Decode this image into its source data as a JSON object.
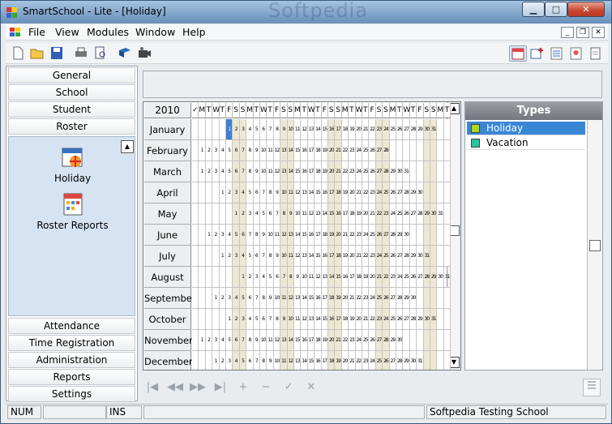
{
  "window": {
    "title": "SmartSchool - Lite - [Holiday]",
    "watermark": "Softpedia",
    "controls": {
      "minimize": "▁",
      "maximize": "□",
      "close": "✕"
    }
  },
  "menu": {
    "items": [
      "File",
      "View",
      "Modules",
      "Window",
      "Help"
    ],
    "mdi": {
      "minimize": "_",
      "restore": "❐",
      "close": "✕"
    }
  },
  "toolbar": {
    "left_icons": [
      "new-icon",
      "open-folder-icon",
      "save-icon",
      "print-icon",
      "print-preview-icon",
      "book-icon",
      "camera-icon"
    ],
    "right_icons": [
      "calendar-icon",
      "add-calendar-icon",
      "card-list-icon",
      "person-card-icon",
      "document-icon"
    ]
  },
  "sidebar": {
    "top_buttons": [
      "General",
      "School",
      "Student",
      "Roster"
    ],
    "pane_items": [
      {
        "label": "Holiday",
        "icon": "calendar-icon"
      },
      {
        "label": "Roster Reports",
        "icon": "report-icon"
      }
    ],
    "bottom_buttons": [
      "Attendance",
      "Time Registration",
      "Administration",
      "Reports",
      "Settings"
    ]
  },
  "calendar": {
    "year": "2010",
    "day_headers": [
      "✓",
      "M",
      "T",
      "W",
      "T",
      "F",
      "S",
      "S",
      "M",
      "T",
      "W",
      "T",
      "F",
      "S",
      "S",
      "M",
      "T",
      "W",
      "T",
      "F",
      "S",
      "S",
      "M",
      "T",
      "W",
      "T",
      "F",
      "S",
      "S",
      "M",
      "T",
      "W",
      "T",
      "F",
      "S",
      "S",
      "M",
      "T"
    ],
    "months": [
      {
        "name": "January",
        "start": 4,
        "days": 31
      },
      {
        "name": "February",
        "start": 0,
        "days": 28
      },
      {
        "name": "March",
        "start": 0,
        "days": 31
      },
      {
        "name": "April",
        "start": 3,
        "days": 30
      },
      {
        "name": "May",
        "start": 5,
        "days": 31
      },
      {
        "name": "June",
        "start": 1,
        "days": 30
      },
      {
        "name": "July",
        "start": 3,
        "days": 31
      },
      {
        "name": "August",
        "start": 6,
        "days": 31
      },
      {
        "name": "September",
        "start": 2,
        "days": 30
      },
      {
        "name": "October",
        "start": 4,
        "days": 31
      },
      {
        "name": "November",
        "start": 0,
        "days": 30
      },
      {
        "name": "December",
        "start": 2,
        "days": 31
      }
    ],
    "holiday_highlight": {
      "month": "January",
      "day": 1
    }
  },
  "types": {
    "header": "Types",
    "items": [
      {
        "label": "Holiday",
        "color": "#a8d820",
        "selected": true
      },
      {
        "label": "Vacation",
        "color": "#22c8a0",
        "selected": false
      }
    ]
  },
  "navigator": [
    "|◀",
    "◀◀",
    "▶▶",
    "▶|",
    "+",
    "−",
    "✓",
    "✕"
  ],
  "statusbar": {
    "num": "NUM",
    "ins": "INS",
    "school": "Softpedia Testing School"
  },
  "colors": {
    "weekend": "#ece8d2",
    "highlight": "#3d7fd1",
    "pane": "#d6e3f3"
  }
}
